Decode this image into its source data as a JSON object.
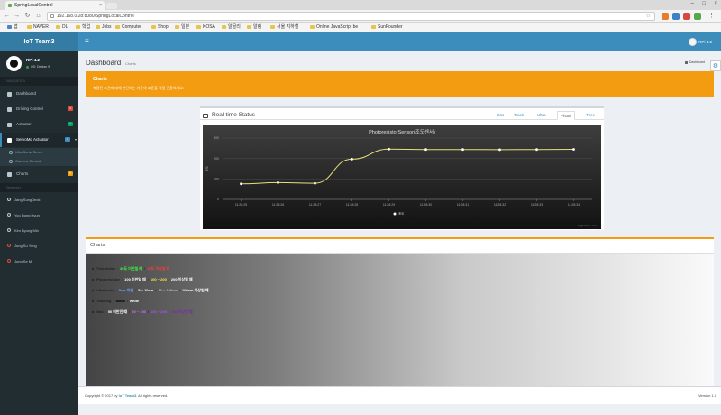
{
  "browser": {
    "tab_title": "SpringLocalControl",
    "url": "192.168.0.28:8080/SpringLocalControl",
    "bookmarks": [
      "앱",
      "NAVER",
      "DL",
      "학업",
      "Jobs",
      "Computer",
      "Shop",
      "일본",
      "KOSA",
      "알골리",
      "알림",
      "서울 지하철",
      "Online JavaScript be",
      "SunFounder"
    ]
  },
  "header": {
    "logo": "IoT Team3",
    "menu_icon": "bars-icon",
    "user": "RPi 4.2"
  },
  "sidebar": {
    "user_name": "RPi 4.2",
    "user_status": "OS: Debian 9",
    "nav_header": "NAVIGATION",
    "items": [
      {
        "label": "Dashboard",
        "icon": "dashboard-icon"
      },
      {
        "label": "Driving Control",
        "icon": "car-icon",
        "badge": "4",
        "badge_color": "#dd4b39"
      },
      {
        "label": "Actuator",
        "icon": "gear-icon",
        "badge": "3",
        "badge_color": "#00a65a"
      },
      {
        "label": "ServoMd Actuator",
        "icon": "servo-icon",
        "badge": "2",
        "badge_color": "#3c8dbc"
      },
      {
        "label": "Charts",
        "icon": "chart-icon",
        "badge": "5",
        "badge_color": "#f39c12"
      }
    ],
    "subitems": [
      "UltraSonic Servo",
      "Camera Control"
    ],
    "people_header": "Developer",
    "people": [
      {
        "name": "Jang SungDeok",
        "color": "#b8c7ce"
      },
      {
        "name": "Yoo Dong Hyun",
        "color": "#b8c7ce"
      },
      {
        "name": "Kim Byung Min",
        "color": "#b8c7ce"
      },
      {
        "name": "Jung Su Yong",
        "color": "#dd4b39"
      },
      {
        "name": "Jung Se Mi",
        "color": "#dd4b39"
      }
    ]
  },
  "content": {
    "title": "Dashboard",
    "subtitle": "Charts",
    "breadcrumb": "Dashboard",
    "callout_title": "Charts",
    "callout_text": "측정된 조건에 대해 판단하는 기준의 표준을 적절 관찰하세요!",
    "realtime": {
      "title": "Real-time Status",
      "tabs": [
        "Gas",
        "Track",
        "Ultra",
        "Photo",
        "Ther."
      ],
      "active_tab": "Photo"
    },
    "charts_title": "Charts",
    "legend_rows": [
      {
        "label": "Thermistor",
        "parts": [
          {
            "text": "30도 미만일 때",
            "color": "#3cff3c"
          },
          {
            "text": "30도 이상일 때",
            "color": "#ff3b3b"
          }
        ]
      },
      {
        "label": "Photoresistor",
        "parts": [
          {
            "text": "100 미만일 때",
            "color": "#ffffff"
          },
          {
            "text": "100 ~ 200",
            "color": "#ffe84a"
          },
          {
            "text": "200 이상일 때",
            "color": "#ffffff"
          }
        ]
      },
      {
        "label": "Ultrasonic",
        "parts": [
          {
            "text": "5cm 미만",
            "color": "#6fa8ff"
          },
          {
            "text": "5 ~ 10cm",
            "color": "#ffffff"
          },
          {
            "text": "10 ~ 100cm",
            "color": "#bbbbbb"
          },
          {
            "text": "100cm 이상일 때",
            "color": "#ffffff"
          }
        ]
      },
      {
        "label": "Tracking",
        "parts": [
          {
            "text": "black",
            "color": "#000000"
          },
          {
            "text": "white",
            "color": "#ffffff"
          }
        ]
      },
      {
        "label": "Gas",
        "parts": [
          {
            "text": "50 미만인 때",
            "color": "#ffffff"
          },
          {
            "text": "50 ~ 100",
            "color": "#d36bff"
          },
          {
            "text": "100 ~ 200",
            "color": "#b04cff"
          },
          {
            "text": "200 이상인 때",
            "color": "#7c2ba8"
          }
        ]
      }
    ]
  },
  "chart_data": {
    "type": "line",
    "title": "PhotoresistorSensor(조도센서)",
    "xlabel": "",
    "ylabel": "조도",
    "x": [
      "11:28:25",
      "11:28:26",
      "11:28:27",
      "11:28:28",
      "11:28:29",
      "11:28:30",
      "11:28:31",
      "11:28:32",
      "11:28:33",
      "11:28:34"
    ],
    "series": [
      {
        "name": "조도",
        "values": [
          76,
          82,
          79,
          197,
          246,
          244,
          244,
          243,
          244,
          245
        ]
      }
    ],
    "y_ticks": [
      0,
      100,
      200,
      300
    ],
    "ylim": [
      0,
      300
    ],
    "credit": "Highcharts.com",
    "grid": true,
    "legend": "bottom-center"
  },
  "footer": {
    "copyright_prefix": "Copyright © 2017 by",
    "brand": "IoT Team3",
    "copyright_suffix": ". All rights reserved.",
    "version": "Version 1.0"
  }
}
